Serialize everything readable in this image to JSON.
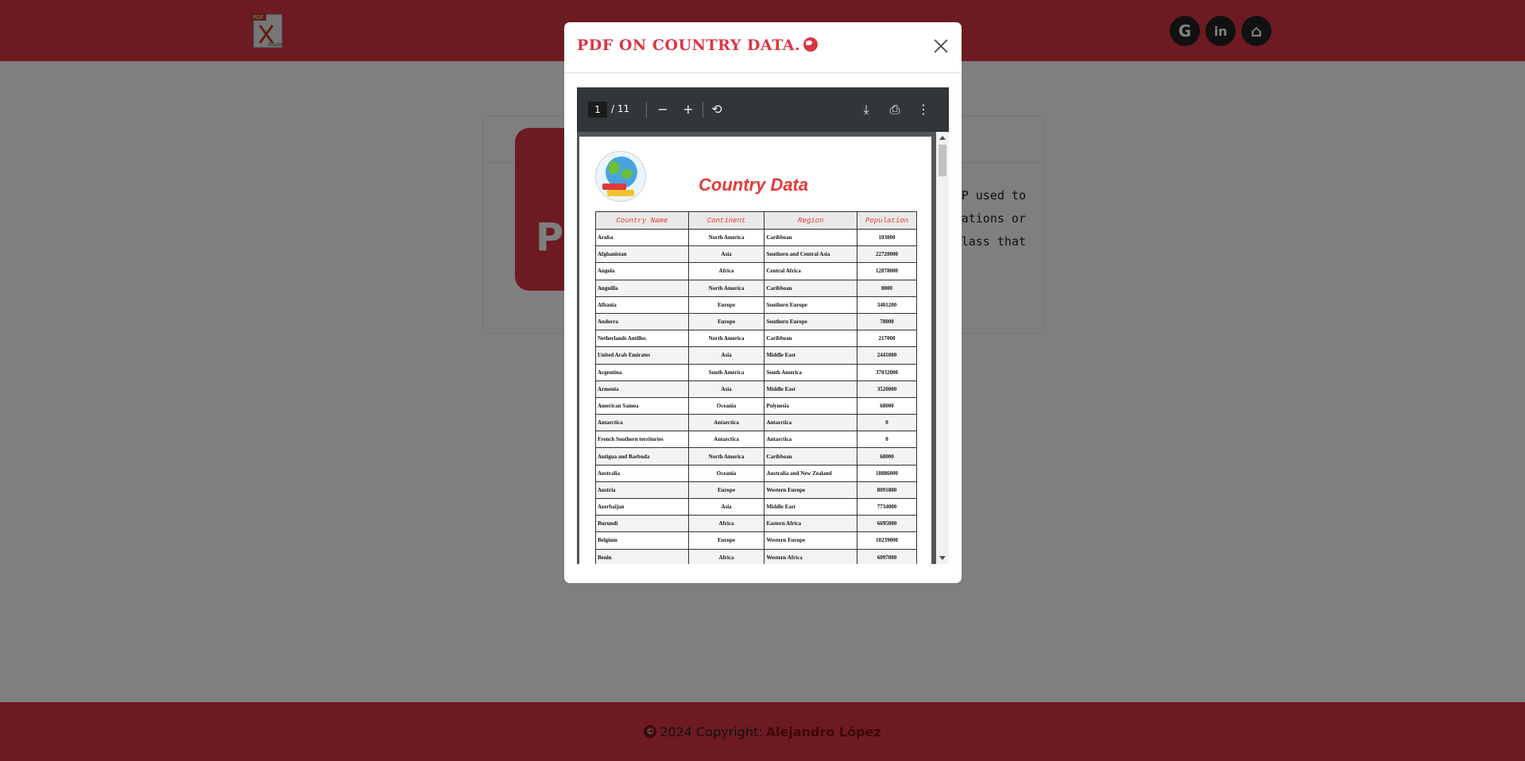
{
  "background": {
    "logo_icon": "pdf-adobe-icon",
    "social": [
      {
        "name": "google-icon",
        "glyph": "G"
      },
      {
        "name": "linkedin-icon",
        "glyph": "in"
      },
      {
        "name": "github-icon",
        "glyph": "⌂"
      }
    ],
    "card_letter": "P",
    "card_text_lines": [
      "HP used to",
      "plications or",
      "class that"
    ],
    "footer": {
      "copyright_icon": "copyright-icon",
      "text": "2024 Copyright:",
      "author": "Alejandro López"
    }
  },
  "modal": {
    "title": "PDF ON COUNTRY DATA.",
    "title_icon": "globe-icon",
    "close_label": "×"
  },
  "viewer": {
    "current_page": "1",
    "page_total": "/ 11",
    "zoom_out": "−",
    "zoom_in": "+",
    "rotate": "⟲",
    "download": "⤓",
    "print": "⎙",
    "more": "⋮"
  },
  "pdf": {
    "title": "Country Data",
    "columns": [
      "Country Name",
      "Continent",
      "Region",
      "Population"
    ],
    "rows": [
      [
        "Aruba",
        "North America",
        "Caribbean",
        "103000"
      ],
      [
        "Afghanistan",
        "Asia",
        "Southern and Central Asia",
        "22720000"
      ],
      [
        "Angola",
        "Africa",
        "Central Africa",
        "12878000"
      ],
      [
        "Anguilla",
        "North America",
        "Caribbean",
        "8000"
      ],
      [
        "Albania",
        "Europe",
        "Southern Europe",
        "3401200"
      ],
      [
        "Andorra",
        "Europe",
        "Southern Europe",
        "78000"
      ],
      [
        "Netherlands Antilles",
        "North America",
        "Caribbean",
        "217000"
      ],
      [
        "United Arab Emirates",
        "Asia",
        "Middle East",
        "2441000"
      ],
      [
        "Argentina",
        "South America",
        "South America",
        "37032000"
      ],
      [
        "Armenia",
        "Asia",
        "Middle East",
        "3520000"
      ],
      [
        "American Samoa",
        "Oceania",
        "Polynesia",
        "68000"
      ],
      [
        "Antarctica",
        "Antarctica",
        "Antarctica",
        "0"
      ],
      [
        "French Southern territories",
        "Antarctica",
        "Antarctica",
        "0"
      ],
      [
        "Antigua and Barbuda",
        "North America",
        "Caribbean",
        "68000"
      ],
      [
        "Australia",
        "Oceania",
        "Australia and New Zealand",
        "18886000"
      ],
      [
        "Austria",
        "Europe",
        "Western Europe",
        "8091800"
      ],
      [
        "Azerbaijan",
        "Asia",
        "Middle East",
        "7734000"
      ],
      [
        "Burundi",
        "Africa",
        "Eastern Africa",
        "6695000"
      ],
      [
        "Belgium",
        "Europe",
        "Western Europe",
        "10239000"
      ],
      [
        "Benin",
        "Africa",
        "Western Africa",
        "6097000"
      ]
    ]
  }
}
